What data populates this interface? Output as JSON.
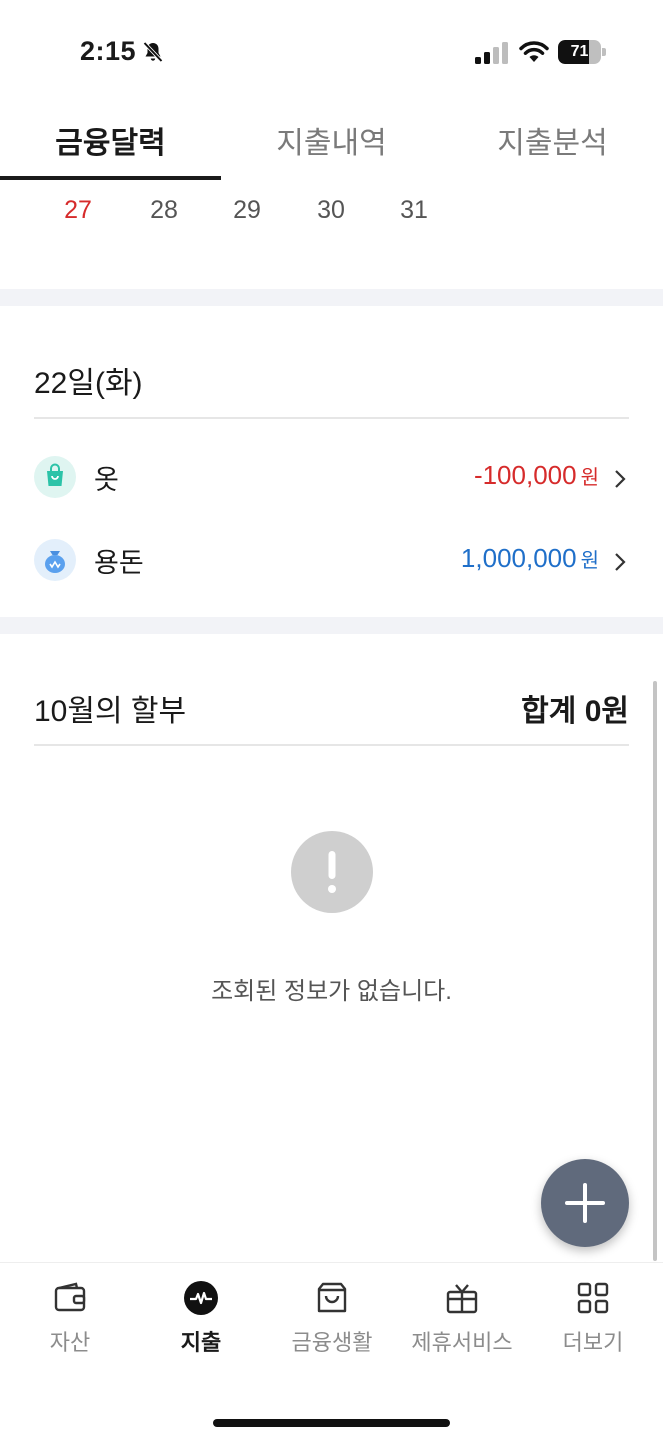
{
  "status_bar": {
    "time": "2:15",
    "battery": "71",
    "battery_level": 0.71
  },
  "tabs": [
    {
      "label": "금융달력",
      "active": true
    },
    {
      "label": "지출내역",
      "active": false
    },
    {
      "label": "지출분석",
      "active": false
    }
  ],
  "dates": [
    "27",
    "28",
    "29",
    "30",
    "31"
  ],
  "day": {
    "title": "22일(화)",
    "transactions": [
      {
        "name": "옷",
        "amount": "-100,000",
        "unit": "원",
        "icon": "shopping-bag-icon"
      },
      {
        "name": "용돈",
        "amount": "1,000,000",
        "unit": "원",
        "icon": "money-bag-icon"
      }
    ]
  },
  "installment": {
    "title": "10월의 할부",
    "total": "합계 0원",
    "empty_message": "조회된 정보가 없습니다."
  },
  "bottom_nav": [
    {
      "label": "자산",
      "icon": "wallet-icon"
    },
    {
      "label": "지출",
      "icon": "pulse-icon"
    },
    {
      "label": "금융생활",
      "icon": "bag-icon"
    },
    {
      "label": "제휴서비스",
      "icon": "gift-icon"
    },
    {
      "label": "더보기",
      "icon": "grid-icon"
    }
  ],
  "colors": {
    "negative": "#d62b2b",
    "positive": "#1f6fc9",
    "fab": "#606a7c"
  }
}
